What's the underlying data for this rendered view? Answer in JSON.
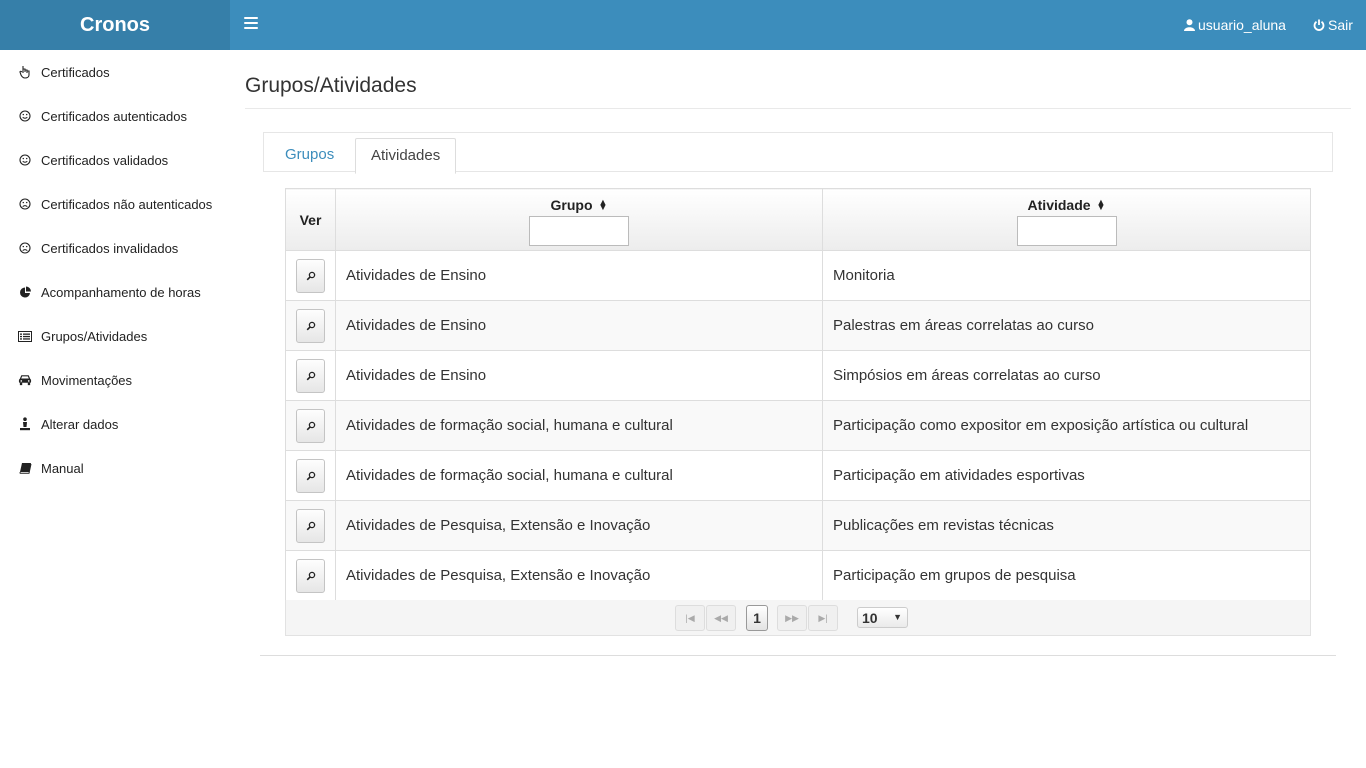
{
  "app": {
    "brand": "Cronos"
  },
  "header": {
    "user_label": "usuario_aluna",
    "logout_label": "Sair"
  },
  "sidebar": {
    "items": [
      {
        "label": "Certificados",
        "icon": "hand-pointer-icon"
      },
      {
        "label": "Certificados autenticados",
        "icon": "smile-icon"
      },
      {
        "label": "Certificados validados",
        "icon": "smile-icon"
      },
      {
        "label": "Certificados não autenticados",
        "icon": "frown-icon"
      },
      {
        "label": "Certificados invalidados",
        "icon": "frown-icon"
      },
      {
        "label": "Acompanhamento de horas",
        "icon": "pie-chart-icon"
      },
      {
        "label": "Grupos/Atividades",
        "icon": "list-alt-icon"
      },
      {
        "label": "Movimentações",
        "icon": "car-icon"
      },
      {
        "label": "Alterar dados",
        "icon": "user-icon"
      },
      {
        "label": "Manual",
        "icon": "book-icon"
      }
    ]
  },
  "main": {
    "title": "Grupos/Atividades",
    "tabs": [
      {
        "label": "Grupos"
      },
      {
        "label": "Atividades"
      }
    ],
    "active_tab": "Atividades"
  },
  "table": {
    "columns": {
      "ver": "Ver",
      "grupo": "Grupo",
      "atividade": "Atividade"
    },
    "filters": {
      "grupo": "",
      "atividade": ""
    },
    "rows": [
      {
        "grupo": "Atividades de Ensino",
        "atividade": "Monitoria"
      },
      {
        "grupo": "Atividades de Ensino",
        "atividade": "Palestras em áreas correlatas ao curso"
      },
      {
        "grupo": "Atividades de Ensino",
        "atividade": "Simpósios em áreas correlatas ao curso"
      },
      {
        "grupo": "Atividades de formação social, humana e cultural",
        "atividade": "Participação como expositor em exposição artística ou cultural"
      },
      {
        "grupo": "Atividades de formação social, humana e cultural",
        "atividade": "Participação em atividades esportivas"
      },
      {
        "grupo": "Atividades de Pesquisa, Extensão e Inovação",
        "atividade": "Publicações em revistas técnicas"
      },
      {
        "grupo": "Atividades de Pesquisa, Extensão e Inovação",
        "atividade": "Participação em grupos de pesquisa"
      }
    ]
  },
  "pager": {
    "first": "|◀",
    "prev": "◀◀",
    "next": "▶▶",
    "last": "▶|",
    "current_page": "1",
    "rows_per_page": "10"
  },
  "colors": {
    "header_blue": "#3c8dbc",
    "brand_blue": "#367fa9",
    "tab_link": "#3c8dbc"
  }
}
